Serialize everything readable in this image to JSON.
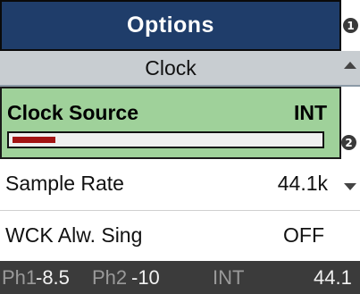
{
  "header": {
    "title": "Options",
    "badge_top": "1"
  },
  "section": {
    "label": "Clock"
  },
  "selected": {
    "label": "Clock Source",
    "value": "INT",
    "level": 0.14,
    "badge": "2",
    "fill_color": "#a31414"
  },
  "rows": [
    {
      "label": "Sample Rate",
      "value": "44.1k"
    },
    {
      "label": "WCK Alw. Sing",
      "value": "OFF"
    }
  ],
  "status": {
    "ph1_label": "Ph1",
    "ph1_value": "-8.5",
    "ph2_label": "Ph2",
    "ph2_value": "-10",
    "clock": "INT",
    "rate": "44.1"
  },
  "colors": {
    "title_bg": "#1f3d6a",
    "selected_bg": "#9fd19a",
    "section_bg": "#c8cdd1",
    "status_bg": "#3b3b3b"
  }
}
